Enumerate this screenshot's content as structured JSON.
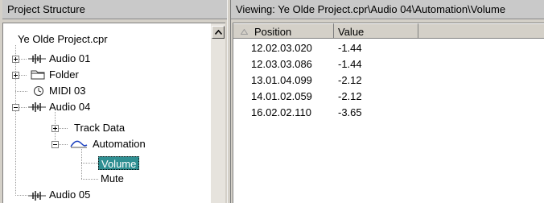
{
  "left_panel": {
    "title": "Project Structure",
    "tree": [
      {
        "label": "Ye Olde Project.cpr"
      },
      {
        "label": "Audio 01"
      },
      {
        "label": "Folder"
      },
      {
        "label": "MIDI 03"
      },
      {
        "label": "Audio 04"
      },
      {
        "label": "Track Data"
      },
      {
        "label": "Automation"
      },
      {
        "label": "Volume"
      },
      {
        "label": "Mute"
      },
      {
        "label": "Audio 05"
      }
    ]
  },
  "right_panel": {
    "title": "Viewing: Ye Olde Project.cpr\\Audio 04\\Automation\\Volume",
    "columns": [
      "Position",
      "Value"
    ],
    "rows": [
      {
        "position": "12.02.03.020",
        "value": "-1.44"
      },
      {
        "position": "12.03.03.086",
        "value": "-1.44"
      },
      {
        "position": "13.01.04.099",
        "value": "-2.12"
      },
      {
        "position": "14.01.02.059",
        "value": "-2.12"
      },
      {
        "position": "16.02.02.110",
        "value": "-3.65"
      }
    ]
  },
  "colors": {
    "selection": "#2f8f92",
    "automation_curve": "#1a3fbf"
  },
  "icons": {
    "audio_track": "audio-waveform-icon",
    "folder": "folder-icon",
    "midi": "midi-clock-icon",
    "automation": "automation-curve-icon",
    "sort": "sort-ascending-icon",
    "scroll_up": "arrow-up-icon"
  }
}
